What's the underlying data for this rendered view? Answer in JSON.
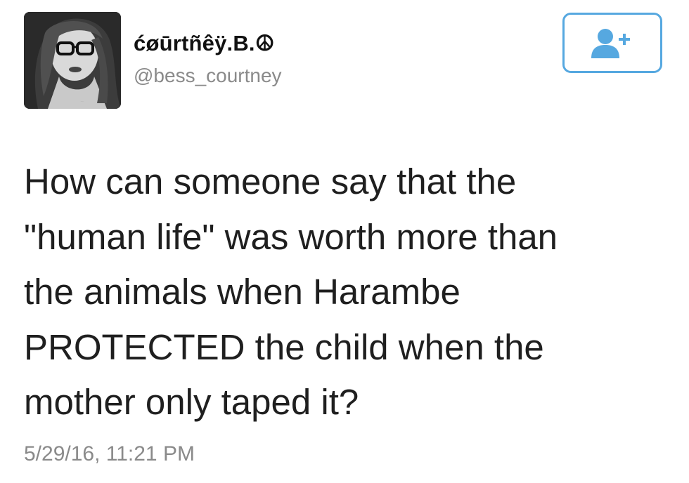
{
  "tweet": {
    "author": {
      "display_name": "ćøūrtñêÿ.B.☮",
      "username": "@bess_courtney",
      "avatar_icon": "profile-photo"
    },
    "follow_button": {
      "icon": "add-user-icon",
      "accent_color": "#56a8e0"
    },
    "text_lines": [
      "How can someone say that the",
      "\"human life\" was worth more than",
      "the animals when Harambe",
      "PROTECTED the child when the",
      "mother only taped it?"
    ],
    "timestamp": "5/29/16, 11:21 PM"
  }
}
